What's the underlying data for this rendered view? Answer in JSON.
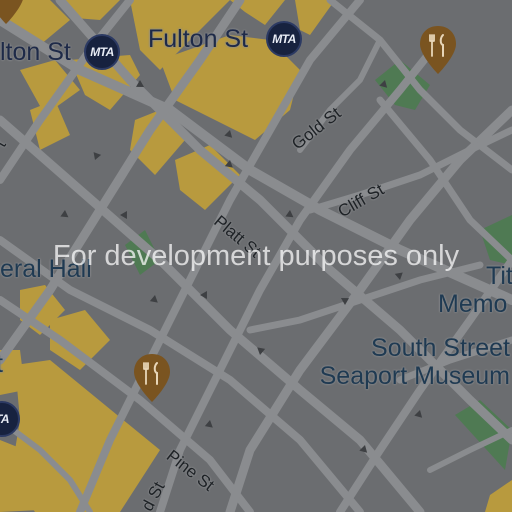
{
  "map": {
    "watermark": "For development purposes only",
    "colors": {
      "background": "#6b6d70",
      "road": "#8a8c8f",
      "building": "#b89a3e",
      "park": "#4f7a53",
      "label_text": "#1f3a52",
      "transit_badge": "#17223f",
      "restaurant_pin": "#7a5420"
    },
    "streets": [
      {
        "id": "fulton-st-left",
        "label": "lton St"
      },
      {
        "id": "fulton-st-right",
        "label": "Fulton St"
      },
      {
        "id": "gold-st",
        "label": "Gold St"
      },
      {
        "id": "cliff-st",
        "label": "Cliff St"
      },
      {
        "id": "platt-st",
        "label": "Platt St"
      },
      {
        "id": "pine-st",
        "label": "Pine St"
      },
      {
        "id": "bottom-st",
        "label": "d St"
      },
      {
        "id": "left-edge-t",
        "label": "t"
      }
    ],
    "pois": [
      {
        "id": "federal-hall",
        "label": "eral Hall"
      },
      {
        "id": "south-street-seaport-museum",
        "line1": "South Street",
        "line2": "Seaport Museum"
      },
      {
        "id": "titanic-memorial",
        "line1": "Tit",
        "line2": "Memo"
      },
      {
        "id": "left-edge-poi",
        "label": "t"
      }
    ],
    "transit": [
      {
        "id": "fulton-st-station-left",
        "badge": "MTA"
      },
      {
        "id": "fulton-st-station-right",
        "badge": "MTA"
      },
      {
        "id": "left-edge-station",
        "badge": "TA"
      }
    ],
    "restaurants": [
      {
        "id": "restaurant-top-right",
        "icon": "fork-knife-icon"
      },
      {
        "id": "restaurant-center",
        "icon": "fork-knife-icon"
      },
      {
        "id": "restaurant-top-left",
        "icon": "fork-knife-icon"
      }
    ]
  }
}
